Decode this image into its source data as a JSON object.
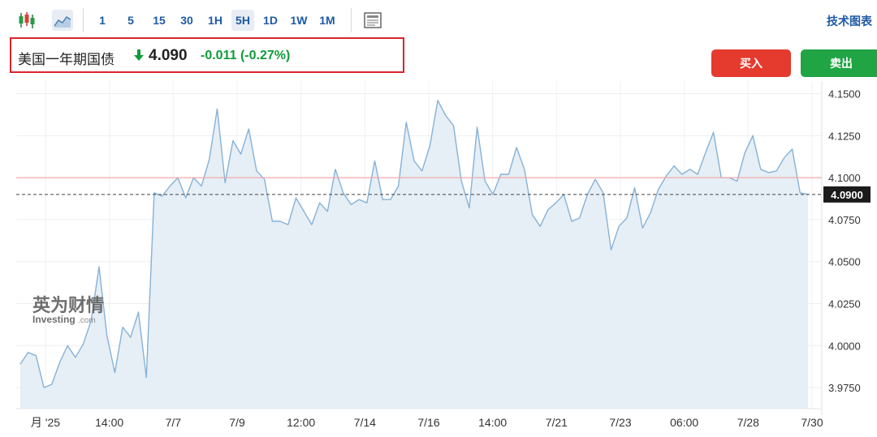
{
  "toolbar": {
    "candles_icon": "candlestick-icon",
    "area_icon": "area-chart-icon",
    "intervals": [
      "1",
      "5",
      "15",
      "30",
      "1H",
      "5H",
      "1D",
      "1W",
      "1M"
    ],
    "active_interval": "5H",
    "news_icon": "news-icon",
    "tech_chart_label": "技术图表"
  },
  "quote": {
    "name": "美国一年期国债",
    "direction": "down",
    "price": "4.090",
    "change": "-0.011",
    "change_pct": "(-0.27%)"
  },
  "actions": {
    "buy": "买入",
    "sell": "卖出"
  },
  "watermark": {
    "cn": "英为财情",
    "en": "Investing",
    "suffix": ".com"
  },
  "colors": {
    "line": "#86b2d6",
    "fill": "#e6eef6",
    "up": "#0f9b3a",
    "buy": "#e53a2e",
    "sell": "#20a444",
    "ref_line": "#f2a9a9",
    "current_tag": "#1b1b1b"
  },
  "chart_data": {
    "type": "area",
    "y_ticks": [
      "4.1500",
      "4.1250",
      "4.1000",
      "4.0750",
      "4.0500",
      "4.0250",
      "4.0000",
      "3.9750"
    ],
    "ylim": [
      3.9625,
      4.1575
    ],
    "x_ticks": [
      "月 '25",
      "14:00",
      "7/7",
      "7/9",
      "12:00",
      "7/14",
      "7/16",
      "14:00",
      "7/21",
      "7/23",
      "06:00",
      "7/28",
      "7/30"
    ],
    "reference_line": 4.1,
    "current_value": 4.09,
    "current_label": "4.0900",
    "grid": true,
    "values": [
      3.989,
      3.996,
      3.994,
      3.975,
      3.977,
      3.99,
      4.0,
      3.993,
      4.001,
      4.015,
      4.047,
      4.006,
      3.984,
      4.011,
      4.005,
      4.02,
      3.981,
      4.091,
      4.089,
      4.095,
      4.1,
      4.088,
      4.1,
      4.095,
      4.111,
      4.141,
      4.097,
      4.122,
      4.114,
      4.129,
      4.104,
      4.099,
      4.074,
      4.074,
      4.072,
      4.088,
      4.08,
      4.072,
      4.085,
      4.08,
      4.105,
      4.091,
      4.084,
      4.087,
      4.085,
      4.11,
      4.087,
      4.087,
      4.095,
      4.133,
      4.11,
      4.104,
      4.119,
      4.146,
      4.137,
      4.131,
      4.098,
      4.082,
      4.13,
      4.098,
      4.09,
      4.102,
      4.102,
      4.118,
      4.105,
      4.078,
      4.071,
      4.081,
      4.085,
      4.09,
      4.074,
      4.076,
      4.09,
      4.099,
      4.091,
      4.057,
      4.071,
      4.076,
      4.094,
      4.07,
      4.079,
      4.093,
      4.101,
      4.107,
      4.102,
      4.105,
      4.102,
      4.115,
      4.127,
      4.1,
      4.1,
      4.098,
      4.115,
      4.125,
      4.105,
      4.103,
      4.104,
      4.112,
      4.117,
      4.091,
      4.09
    ]
  }
}
